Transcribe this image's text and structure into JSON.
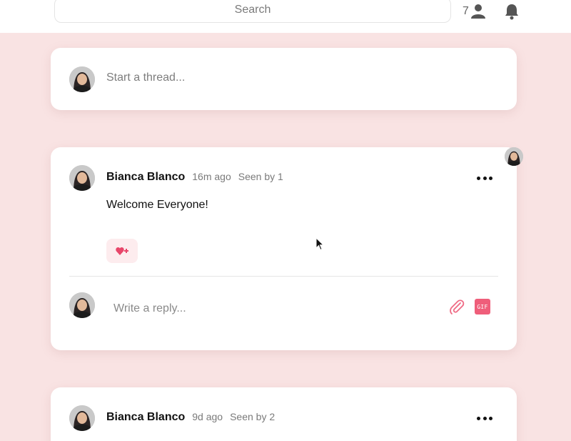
{
  "header": {
    "search_placeholder": "Search",
    "member_count": "7"
  },
  "composer": {
    "placeholder": "Start a thread..."
  },
  "posts": [
    {
      "author": "Bianca Blanco",
      "time": "16m ago",
      "seen": "Seen by 1",
      "body": "Welcome Everyone!",
      "reply_placeholder": "Write a reply...",
      "gif_label": "GIF"
    },
    {
      "author": "Bianca Blanco",
      "time": "9d ago",
      "seen": "Seen by 2"
    }
  ],
  "colors": {
    "background": "#f9e3e3",
    "accent": "#ef5e7a"
  }
}
